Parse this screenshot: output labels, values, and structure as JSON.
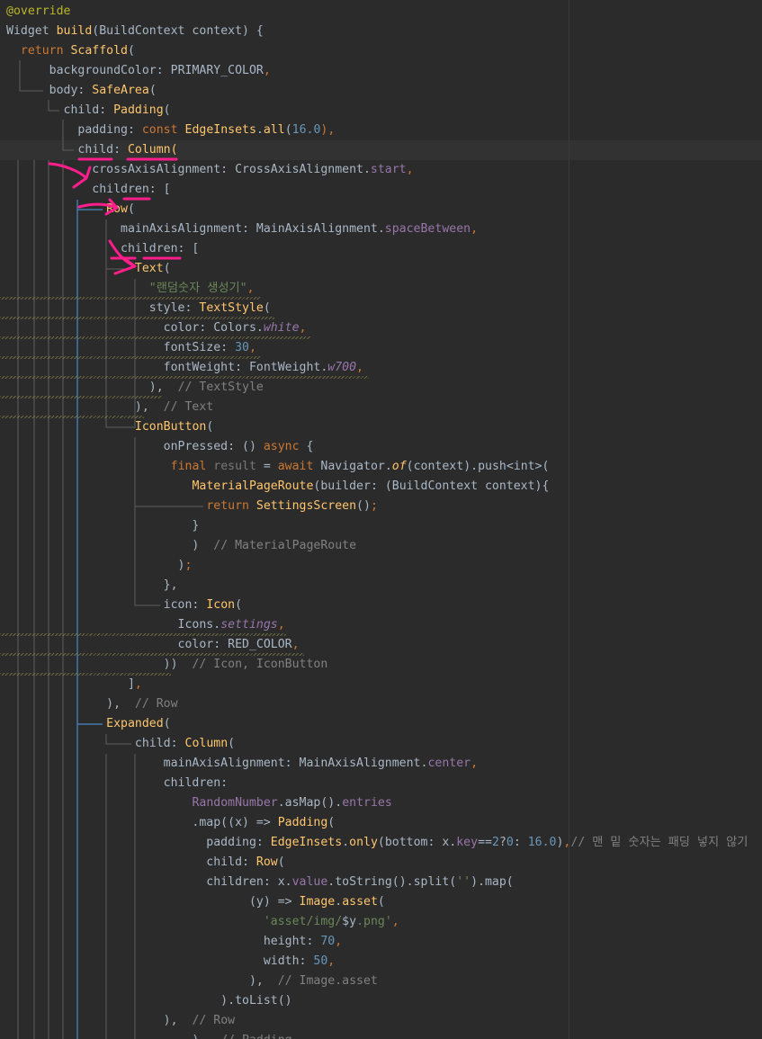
{
  "editor": {
    "language": "dart",
    "colors": {
      "background": "#2b2b2b",
      "current_line": "#323232",
      "annotation_marks": "#ff1e8c",
      "guide_blue": "#4a88c7",
      "guide_gray": "#6a6a6a"
    },
    "lines": [
      {
        "tokens": [
          {
            "t": "@override",
            "k": "an"
          }
        ]
      },
      {
        "tokens": [
          {
            "t": "Widget ",
            "k": "id"
          },
          {
            "t": "build",
            "k": "fn"
          },
          {
            "t": "(BuildContext context) {",
            "k": "id"
          }
        ]
      },
      {
        "tokens": [
          {
            "t": "  ",
            "k": "p"
          },
          {
            "t": "return ",
            "k": "kw"
          },
          {
            "t": "Scaffold",
            "k": "cls"
          },
          {
            "t": "(",
            "k": "p"
          }
        ]
      },
      {
        "tokens": [
          {
            "t": "      backgroundColor: ",
            "k": "p"
          },
          {
            "t": "PRIMARY_COLOR",
            "k": "id"
          },
          {
            "t": ",",
            "k": "pu"
          }
        ]
      },
      {
        "tokens": [
          {
            "t": "      body: ",
            "k": "p"
          },
          {
            "t": "SafeArea",
            "k": "cls"
          },
          {
            "t": "(",
            "k": "p"
          }
        ]
      },
      {
        "tokens": [
          {
            "t": "        child: ",
            "k": "p"
          },
          {
            "t": "Padding",
            "k": "cls"
          },
          {
            "t": "(",
            "k": "p"
          }
        ]
      },
      {
        "tokens": [
          {
            "t": "          padding: ",
            "k": "p"
          },
          {
            "t": "const ",
            "k": "kw"
          },
          {
            "t": "EdgeInsets",
            "k": "cls"
          },
          {
            "t": ".",
            "k": "p"
          },
          {
            "t": "all",
            "k": "fn"
          },
          {
            "t": "(",
            "k": "p"
          },
          {
            "t": "16.0",
            "k": "num"
          },
          {
            "t": "),",
            "k": "pu"
          }
        ]
      },
      {
        "tokens": [
          {
            "t": "          child: ",
            "k": "p"
          },
          {
            "t": "Column",
            "k": "cls"
          },
          {
            "t": "(",
            "k": "fn"
          }
        ]
      },
      {
        "tokens": [
          {
            "t": "            crossAxisAlignment: CrossAxisAlignment.",
            "k": "p"
          },
          {
            "t": "start",
            "k": "fld"
          },
          {
            "t": ",",
            "k": "pu"
          }
        ]
      },
      {
        "tokens": [
          {
            "t": "            children: [",
            "k": "p"
          }
        ]
      },
      {
        "tokens": [
          {
            "t": "              ",
            "k": "p"
          },
          {
            "t": "Row",
            "k": "cls"
          },
          {
            "t": "(",
            "k": "p"
          }
        ]
      },
      {
        "tokens": [
          {
            "t": "                mainAxisAlignment: MainAxisAlignment.",
            "k": "p"
          },
          {
            "t": "spaceBetween",
            "k": "fld"
          },
          {
            "t": ",",
            "k": "pu"
          }
        ]
      },
      {
        "tokens": [
          {
            "t": "                children: [",
            "k": "p"
          }
        ]
      },
      {
        "tokens": [
          {
            "t": "                  ",
            "k": "p"
          },
          {
            "t": "Text",
            "k": "cls"
          },
          {
            "t": "(",
            "k": "p"
          }
        ]
      },
      {
        "tokens": [
          {
            "t": "                    ",
            "k": "p"
          },
          {
            "t": "\"랜덤숫자 생성기\"",
            "k": "str"
          },
          {
            "t": ",",
            "k": "pu"
          }
        ]
      },
      {
        "tokens": [
          {
            "t": "                    style: ",
            "k": "p"
          },
          {
            "t": "TextStyle",
            "k": "cls"
          },
          {
            "t": "(",
            "k": "p"
          }
        ]
      },
      {
        "tokens": [
          {
            "t": "                      color: Colors.",
            "k": "p"
          },
          {
            "t": "white",
            "k": "it"
          },
          {
            "t": ",",
            "k": "pu"
          }
        ]
      },
      {
        "tokens": [
          {
            "t": "                      fontSize: ",
            "k": "p"
          },
          {
            "t": "30",
            "k": "num"
          },
          {
            "t": ",",
            "k": "pu"
          }
        ]
      },
      {
        "tokens": [
          {
            "t": "                      fontWeight: FontWeight.",
            "k": "p"
          },
          {
            "t": "w700",
            "k": "it"
          },
          {
            "t": ",",
            "k": "pu"
          }
        ]
      },
      {
        "tokens": [
          {
            "t": "                    ),  ",
            "k": "p"
          },
          {
            "t": "// TextStyle",
            "k": "cm"
          }
        ]
      },
      {
        "tokens": [
          {
            "t": "                  ),  ",
            "k": "p"
          },
          {
            "t": "// Text",
            "k": "cm"
          }
        ]
      },
      {
        "tokens": [
          {
            "t": "                  ",
            "k": "p"
          },
          {
            "t": "IconButton",
            "k": "cls"
          },
          {
            "t": "(",
            "k": "p"
          }
        ]
      },
      {
        "tokens": [
          {
            "t": "                      onPressed: () ",
            "k": "p"
          },
          {
            "t": "async ",
            "k": "kw"
          },
          {
            "t": "{",
            "k": "p"
          }
        ]
      },
      {
        "tokens": [
          {
            "t": "                       ",
            "k": "p"
          },
          {
            "t": "final ",
            "k": "kw"
          },
          {
            "t": "result ",
            "k": "dim"
          },
          {
            "t": "= ",
            "k": "p"
          },
          {
            "t": "await ",
            "k": "kw"
          },
          {
            "t": "Navigator.",
            "k": "p"
          },
          {
            "t": "of",
            "k": "mt"
          },
          {
            "t": "(context).push<int>(",
            "k": "p"
          }
        ]
      },
      {
        "tokens": [
          {
            "t": "                          ",
            "k": "p"
          },
          {
            "t": "MaterialPageRoute",
            "k": "cls"
          },
          {
            "t": "(builder: (BuildContext context){",
            "k": "p"
          }
        ]
      },
      {
        "tokens": [
          {
            "t": "                            ",
            "k": "p"
          },
          {
            "t": "return ",
            "k": "kw"
          },
          {
            "t": "SettingsScreen",
            "k": "cls"
          },
          {
            "t": "()",
            "k": "p"
          },
          {
            "t": ";",
            "k": "pu"
          }
        ]
      },
      {
        "tokens": [
          {
            "t": "                          }",
            "k": "p"
          }
        ]
      },
      {
        "tokens": [
          {
            "t": "                          )  ",
            "k": "p"
          },
          {
            "t": "// MaterialPageRoute",
            "k": "cm"
          }
        ]
      },
      {
        "tokens": [
          {
            "t": "                        )",
            "k": "p"
          },
          {
            "t": ";",
            "k": "pu"
          }
        ]
      },
      {
        "tokens": [
          {
            "t": "                      },",
            "k": "p"
          }
        ]
      },
      {
        "tokens": [
          {
            "t": "                      icon: ",
            "k": "p"
          },
          {
            "t": "Icon",
            "k": "cls"
          },
          {
            "t": "(",
            "k": "p"
          }
        ]
      },
      {
        "tokens": [
          {
            "t": "                        Icons.",
            "k": "p"
          },
          {
            "t": "settings",
            "k": "it"
          },
          {
            "t": ",",
            "k": "pu"
          }
        ]
      },
      {
        "tokens": [
          {
            "t": "                        color: ",
            "k": "p"
          },
          {
            "t": "RED_COLOR",
            "k": "id"
          },
          {
            "t": ",",
            "k": "pu"
          }
        ]
      },
      {
        "tokens": [
          {
            "t": "                      ))  ",
            "k": "p"
          },
          {
            "t": "// Icon, IconButton",
            "k": "cm"
          }
        ]
      },
      {
        "tokens": [
          {
            "t": "                 ]",
            "k": "p"
          },
          {
            "t": ",",
            "k": "pu"
          }
        ]
      },
      {
        "tokens": [
          {
            "t": "              ),  ",
            "k": "p"
          },
          {
            "t": "// Row",
            "k": "cm"
          }
        ]
      },
      {
        "tokens": [
          {
            "t": "              ",
            "k": "p"
          },
          {
            "t": "Expanded",
            "k": "cls"
          },
          {
            "t": "(",
            "k": "p"
          }
        ]
      },
      {
        "tokens": [
          {
            "t": "                  child: ",
            "k": "p"
          },
          {
            "t": "Column",
            "k": "cls"
          },
          {
            "t": "(",
            "k": "p"
          }
        ]
      },
      {
        "tokens": [
          {
            "t": "                      mainAxisAlignment: MainAxisAlignment.",
            "k": "p"
          },
          {
            "t": "center",
            "k": "fld"
          },
          {
            "t": ",",
            "k": "pu"
          }
        ]
      },
      {
        "tokens": [
          {
            "t": "                      children:",
            "k": "p"
          }
        ]
      },
      {
        "tokens": [
          {
            "t": "                          ",
            "k": "p"
          },
          {
            "t": "RandomNumber",
            "k": "fld"
          },
          {
            "t": ".asMap().",
            "k": "p"
          },
          {
            "t": "entries",
            "k": "fld"
          }
        ]
      },
      {
        "tokens": [
          {
            "t": "                          .map((x) => ",
            "k": "p"
          },
          {
            "t": "Padding",
            "k": "cls"
          },
          {
            "t": "(",
            "k": "p"
          }
        ]
      },
      {
        "tokens": [
          {
            "t": "                            padding: ",
            "k": "p"
          },
          {
            "t": "EdgeInsets",
            "k": "cls"
          },
          {
            "t": ".",
            "k": "p"
          },
          {
            "t": "only",
            "k": "fn"
          },
          {
            "t": "(bottom: x.",
            "k": "p"
          },
          {
            "t": "key",
            "k": "fld"
          },
          {
            "t": "==",
            "k": "p"
          },
          {
            "t": "2",
            "k": "num"
          },
          {
            "t": "?",
            "k": "p"
          },
          {
            "t": "0",
            "k": "num"
          },
          {
            "t": ": ",
            "k": "p"
          },
          {
            "t": "16.0",
            "k": "num"
          },
          {
            "t": ")",
            "k": "p"
          },
          {
            "t": ",",
            "k": "pu"
          },
          {
            "t": "// 맨 밑 숫자는 패딩 넣지 않기",
            "k": "cm"
          }
        ]
      },
      {
        "tokens": [
          {
            "t": "                            child: ",
            "k": "p"
          },
          {
            "t": "Row",
            "k": "cls"
          },
          {
            "t": "(",
            "k": "p"
          }
        ]
      },
      {
        "tokens": [
          {
            "t": "                            children: x.",
            "k": "p"
          },
          {
            "t": "value",
            "k": "fld"
          },
          {
            "t": ".toString().split(",
            "k": "p"
          },
          {
            "t": "''",
            "k": "str"
          },
          {
            "t": ").map(",
            "k": "p"
          }
        ]
      },
      {
        "tokens": [
          {
            "t": "                                  (y) => ",
            "k": "p"
          },
          {
            "t": "Image",
            "k": "cls"
          },
          {
            "t": ".",
            "k": "p"
          },
          {
            "t": "asset",
            "k": "fn"
          },
          {
            "t": "(",
            "k": "p"
          }
        ]
      },
      {
        "tokens": [
          {
            "t": "                                    ",
            "k": "p"
          },
          {
            "t": "'asset/img/",
            "k": "str"
          },
          {
            "t": "$y",
            "k": "id"
          },
          {
            "t": ".png'",
            "k": "str"
          },
          {
            "t": ",",
            "k": "pu"
          }
        ]
      },
      {
        "tokens": [
          {
            "t": "                                    height: ",
            "k": "p"
          },
          {
            "t": "70",
            "k": "num"
          },
          {
            "t": ",",
            "k": "pu"
          }
        ]
      },
      {
        "tokens": [
          {
            "t": "                                    width: ",
            "k": "p"
          },
          {
            "t": "50",
            "k": "num"
          },
          {
            "t": ",",
            "k": "pu"
          }
        ]
      },
      {
        "tokens": [
          {
            "t": "                                  ),  ",
            "k": "p"
          },
          {
            "t": "// Image.asset",
            "k": "cm"
          }
        ]
      },
      {
        "tokens": [
          {
            "t": "                              ).toList()",
            "k": "p"
          }
        ]
      },
      {
        "tokens": [
          {
            "t": "                      ),  ",
            "k": "p"
          },
          {
            "t": "// Row",
            "k": "cm"
          }
        ]
      },
      {
        "tokens": [
          {
            "t": "                          ),  ",
            "k": "p"
          },
          {
            "t": "// Padding",
            "k": "cm"
          }
        ]
      }
    ]
  }
}
